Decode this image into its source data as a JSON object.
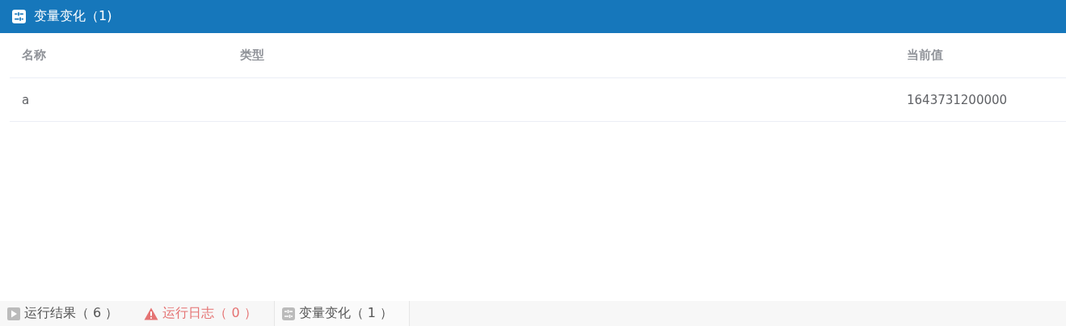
{
  "panel": {
    "title": "变量变化（1)"
  },
  "table": {
    "columns": [
      "名称",
      "类型",
      "当前值"
    ],
    "rows": [
      [
        "a",
        "",
        "1643731200000"
      ]
    ]
  },
  "tabs": [
    {
      "label": "运行结果（ 6 ）",
      "kind": "result",
      "selected": false
    },
    {
      "label": "运行日志（ 0 ）",
      "kind": "log",
      "selected": false
    },
    {
      "label": "变量变化（ 1 ）",
      "kind": "variables",
      "selected": true
    }
  ]
}
